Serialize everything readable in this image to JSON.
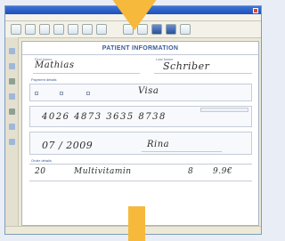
{
  "window": {
    "title": "",
    "menus": [
      "",
      "",
      "",
      "",
      "",
      ""
    ]
  },
  "form": {
    "title": "PATIENT INFORMATION",
    "first_name_label": "First Name",
    "last_name_label": "Last Name",
    "first_name_value": "Mathias",
    "last_name_value": "Schriber",
    "section_payment": "Payment details",
    "card_value": "Visa",
    "card_number_value": "4026 4873 3635 8738",
    "expiry_value": "07 / 2009",
    "holder_value": "Rina",
    "section_order": "Order details",
    "qty_value": "20",
    "item_value": "Multivitamin",
    "price_value": "8",
    "total_value": "9.9€"
  },
  "colors": {
    "arrow": "#f6b93b",
    "accent": "#3a5a9a"
  }
}
